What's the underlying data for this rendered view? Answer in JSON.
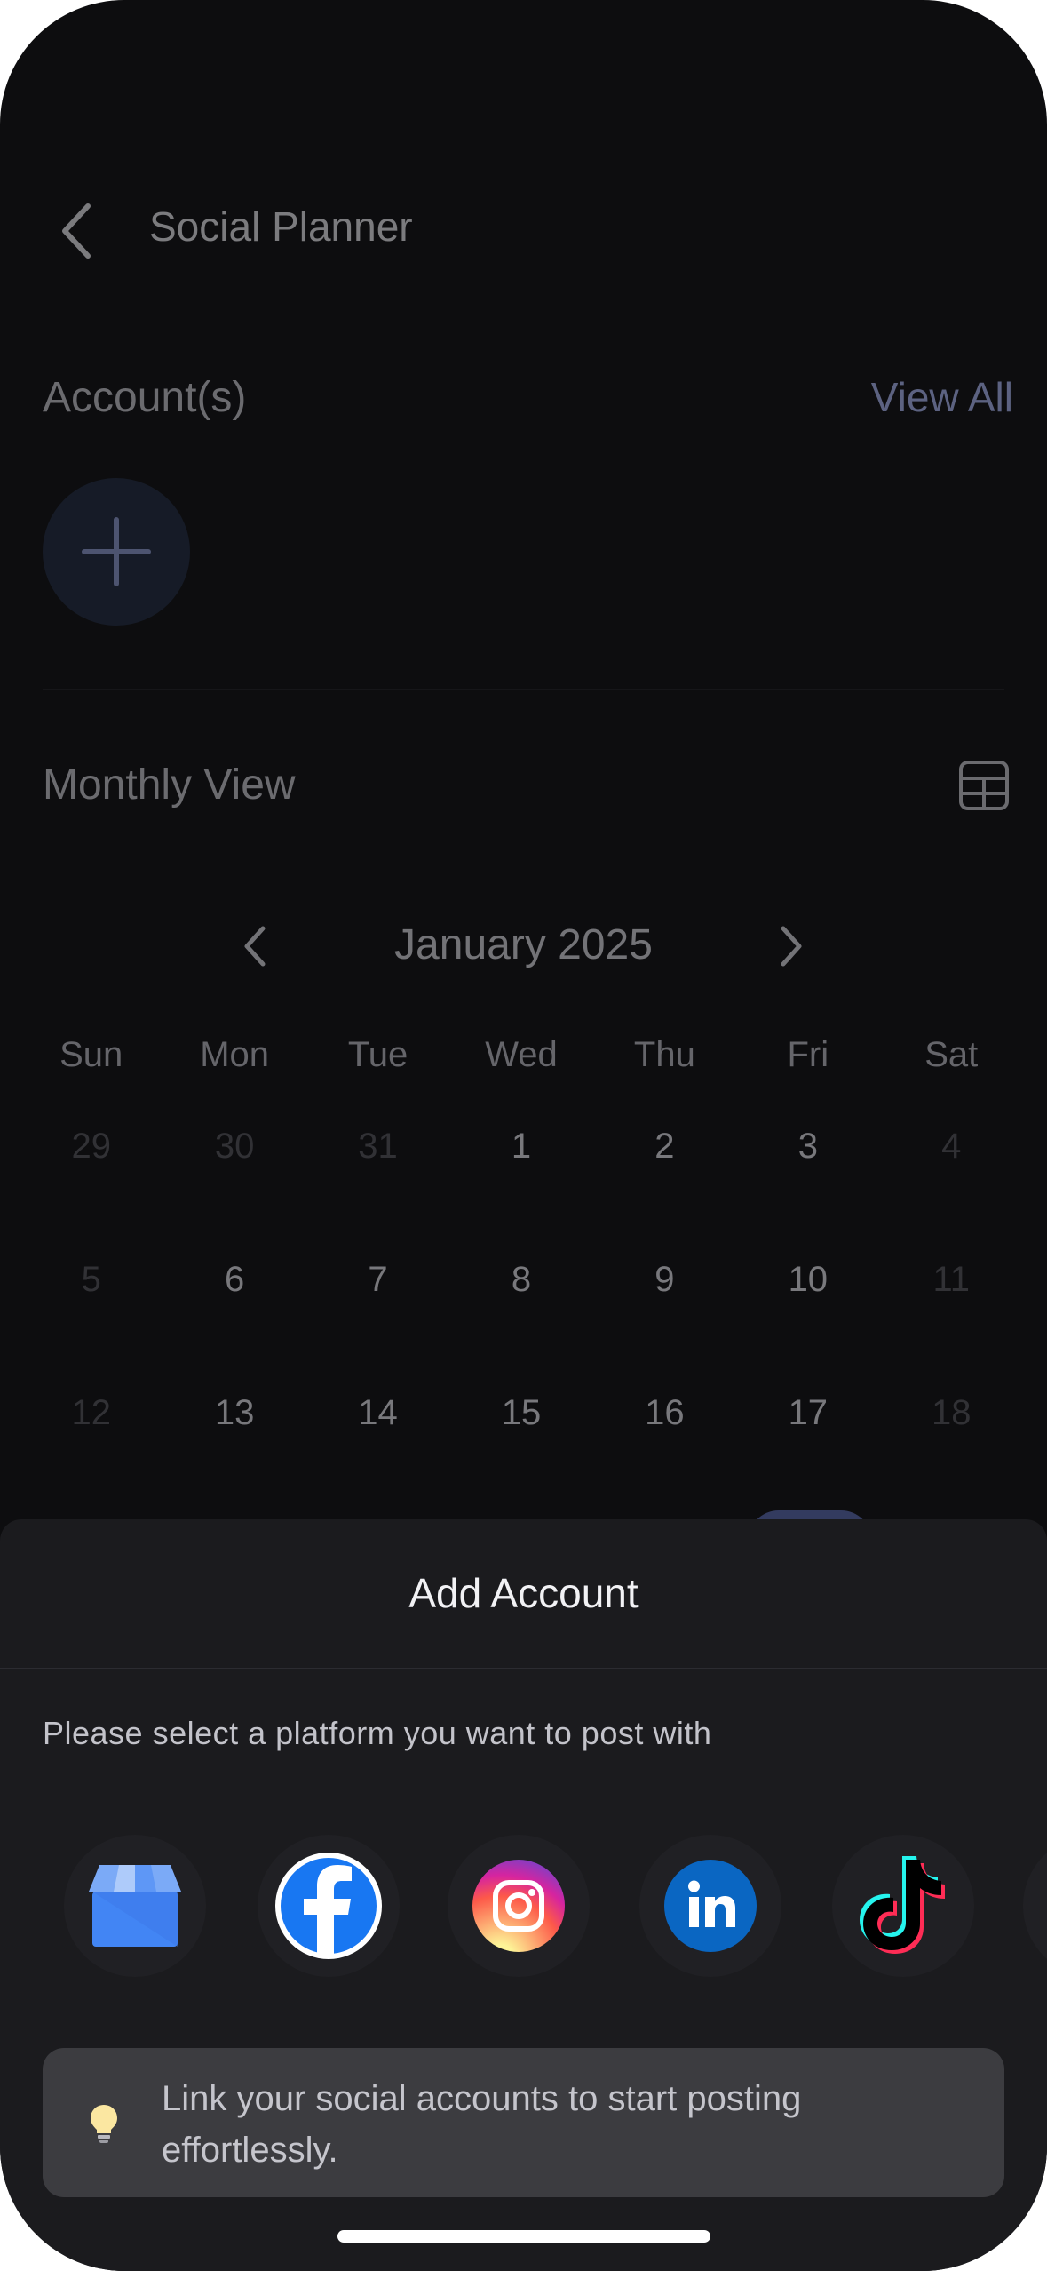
{
  "header": {
    "title": "Social Planner"
  },
  "accounts": {
    "label": "Account(s)",
    "view_all": "View All"
  },
  "monthly": {
    "label": "Monthly View"
  },
  "calendar": {
    "month": "January 2025",
    "weekdays": [
      "Sun",
      "Mon",
      "Tue",
      "Wed",
      "Thu",
      "Fri",
      "Sat"
    ],
    "weeks": [
      [
        {
          "d": "29",
          "m": true
        },
        {
          "d": "30",
          "m": true
        },
        {
          "d": "31",
          "m": true
        },
        {
          "d": "1"
        },
        {
          "d": "2"
        },
        {
          "d": "3"
        },
        {
          "d": "4",
          "m": true
        }
      ],
      [
        {
          "d": "5",
          "m": true
        },
        {
          "d": "6"
        },
        {
          "d": "7"
        },
        {
          "d": "8"
        },
        {
          "d": "9"
        },
        {
          "d": "10"
        },
        {
          "d": "11",
          "m": true
        }
      ],
      [
        {
          "d": "12",
          "m": true
        },
        {
          "d": "13"
        },
        {
          "d": "14"
        },
        {
          "d": "15"
        },
        {
          "d": "16"
        },
        {
          "d": "17"
        },
        {
          "d": "18",
          "m": true
        }
      ]
    ]
  },
  "sheet": {
    "title": "Add Account",
    "subtitle": "Please select a platform you want to post with",
    "platforms": [
      "google-business-icon",
      "facebook-icon",
      "instagram-icon",
      "linkedin-icon",
      "tiktok-icon"
    ],
    "tip": "Link your social accounts to start posting effortlessly."
  },
  "colors": {
    "accent": "#aab7f2",
    "selected": "#596ab0",
    "sheet_bg": "#1b1b1e",
    "tip_bg": "#3c3c40"
  }
}
